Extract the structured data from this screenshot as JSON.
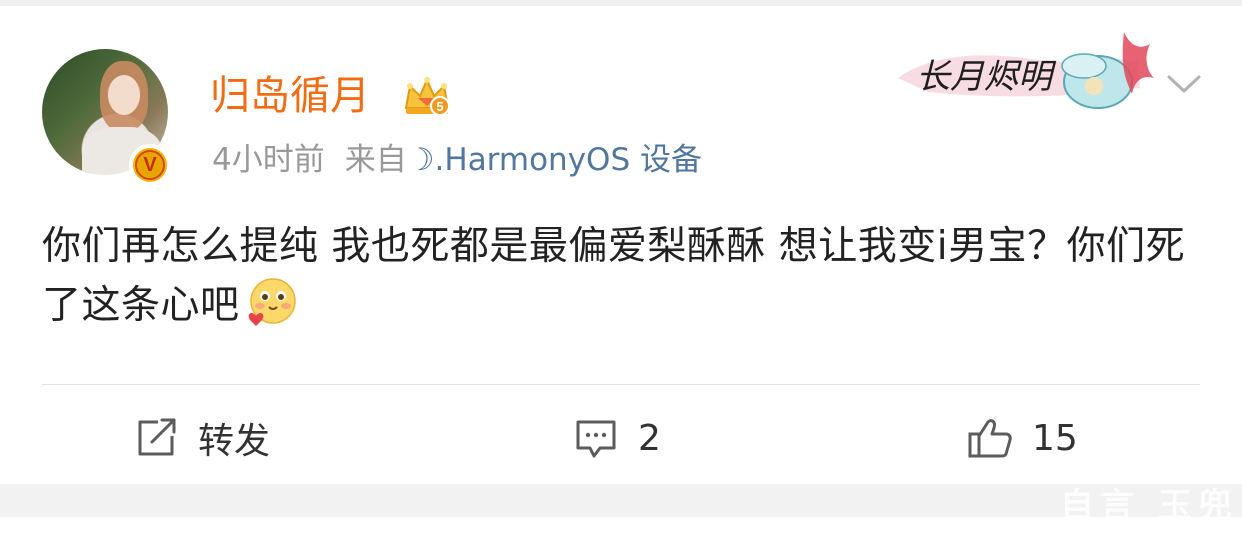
{
  "post": {
    "username": "归岛循月",
    "crown_level": "5",
    "time": "4小时前",
    "source_label": "来自",
    "source_device": "☽.HarmonyOS 设备",
    "text": "你们再怎么提纯 我也死都是最偏爱梨酥酥 想让我变i男宝？你们死了这条心吧",
    "banner_title": "长月烬明"
  },
  "actions": {
    "repost_label": "转发",
    "comment_count": "2",
    "like_count": "15"
  },
  "watermark": "自言 玉兜",
  "colors": {
    "username": "#f26c13",
    "source_link": "#51779e",
    "meta": "#999999",
    "verified_badge": "#f5b400"
  },
  "icons": [
    "verified-v-icon",
    "crown-level-icon",
    "chevron-down-icon",
    "repost-icon",
    "comment-icon",
    "like-icon",
    "blush-heart-emoji"
  ]
}
